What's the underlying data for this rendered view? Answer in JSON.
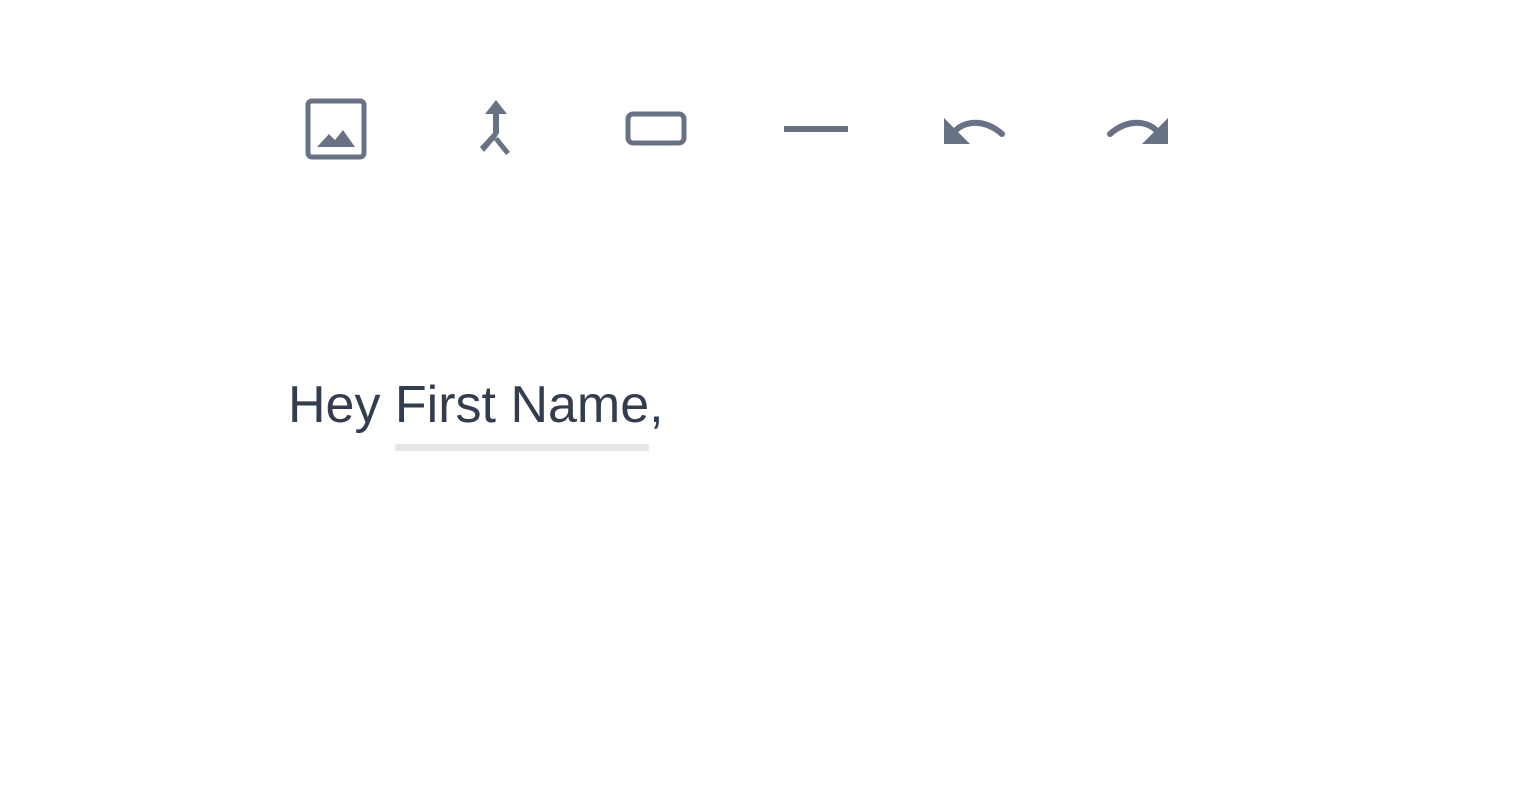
{
  "colors": {
    "icon": "#697284",
    "text": "#333d4d",
    "merge_tag_underline": "#e5e6ea",
    "background": "#ffffff"
  },
  "toolbar": {
    "items": [
      {
        "icon": "image-icon"
      },
      {
        "icon": "merge-icon"
      },
      {
        "icon": "button-icon"
      },
      {
        "icon": "divider-icon"
      },
      {
        "icon": "undo-icon"
      },
      {
        "icon": "redo-icon"
      }
    ]
  },
  "editor": {
    "greeting_prefix": "Hey ",
    "merge_tag_label": "First Name",
    "greeting_suffix": ","
  }
}
